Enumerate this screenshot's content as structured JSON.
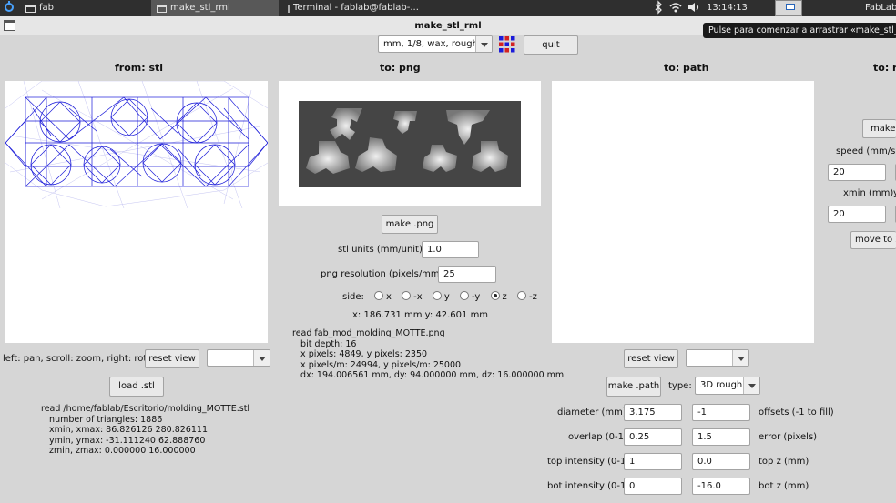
{
  "taskbar": {
    "tasks": [
      {
        "label": "fab"
      },
      {
        "label": "make_stl_rml"
      },
      {
        "label": "Terminal - fablab@fablab-..."
      }
    ],
    "clock": "13:14:13",
    "user": "FabLab"
  },
  "window": {
    "title": "make_stl_rml",
    "tooltip": "Pulse para comenzar a arrastrar «make_stl_rml»",
    "process_select": "mm, 1/8, wax, rough",
    "quit_label": "quit"
  },
  "stl": {
    "header": "from: stl",
    "hint": "left: pan, scroll: zoom, right: rotate",
    "reset_view_label": "reset view",
    "view_select": "",
    "load_label": "load .stl",
    "info": [
      "read /home/fablab/Escritorio/molding_MOTTE.stl",
      "   number of triangles: 1886",
      "   xmin, xmax: 86.826126 280.826111",
      "   ymin, ymax: -31.111240 62.888760",
      "   zmin, zmax: 0.000000 16.000000"
    ]
  },
  "png": {
    "header": "to: png",
    "make_label": "make .png",
    "units_label": "stl units (mm/unit):",
    "units_value": "1.0",
    "resolution_label": "png resolution (pixels/mm):",
    "resolution_value": "25",
    "side_label": "side:",
    "sides": [
      "x",
      "-x",
      "y",
      "-y",
      "z",
      "-z"
    ],
    "side_selected": "z",
    "dims": "x: 186.731 mm  y: 42.601 mm",
    "info": [
      "read fab_mod_molding_MOTTE.png",
      "   bit depth: 16",
      "   x pixels: 4849, y pixels: 2350",
      "   x pixels/m: 24994, y pixels/m: 25000",
      "   dx: 194.006561 mm, dy: 94.000000 mm, dz: 16.000000 mm"
    ]
  },
  "path": {
    "header": "to: path",
    "reset_view_label": "reset view",
    "view_select": "",
    "make_label": "make .path",
    "type_label": "type:",
    "type_value": "3D rough",
    "params": [
      {
        "label": "diameter (mm)",
        "value": "3.175",
        "value2": "-1",
        "label2": "offsets (-1 to fill)"
      },
      {
        "label": "overlap (0-1)",
        "value": "0.25",
        "value2": "1.5",
        "label2": "error (pixels)"
      },
      {
        "label": "top intensity (0-1)",
        "value": "1",
        "value2": "0.0",
        "label2": "top z (mm)"
      },
      {
        "label": "bot intensity (0-1)",
        "value": "0",
        "value2": "-16.0",
        "label2": "bot z (mm)"
      }
    ]
  },
  "rml": {
    "header": "to: r",
    "make_label": "make .",
    "speed_label": "speed (mm/s)",
    "speed_value": "20",
    "xmin_label": "xmin (mm)",
    "xmin_value": "20",
    "ymin_label_fragment": "y",
    "move_label": "move to xm"
  },
  "colors": {
    "background": "#d6d6d6",
    "mesh": "#1b1bd9",
    "taskbar": "#2f2f2f"
  }
}
